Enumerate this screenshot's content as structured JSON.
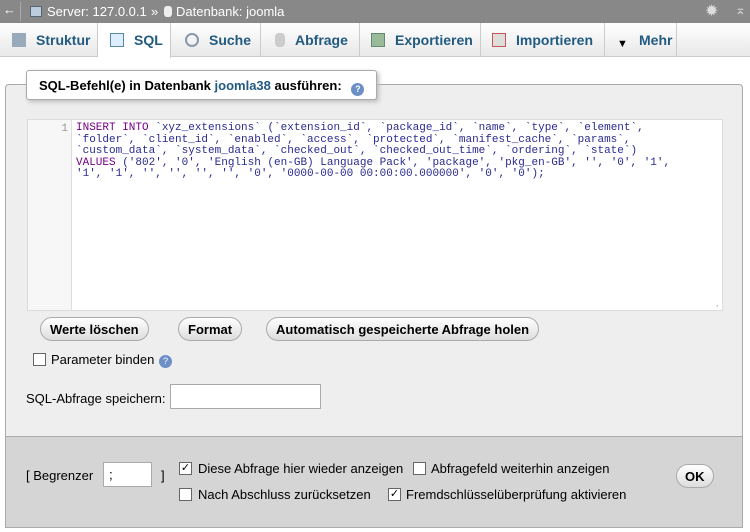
{
  "topbar": {
    "server": "Server: 127.0.0.1",
    "sep": "»",
    "database": "Datenbank: joomla"
  },
  "tabs": [
    {
      "label": "Struktur",
      "icon": "structure-icon"
    },
    {
      "label": "SQL",
      "icon": "sql-icon",
      "active": true
    },
    {
      "label": "Suche",
      "icon": "search-icon"
    },
    {
      "label": "Abfrage",
      "icon": "query-icon"
    },
    {
      "label": "Exportieren",
      "icon": "export-icon"
    },
    {
      "label": "Importieren",
      "icon": "import-icon"
    },
    {
      "label": "Mehr",
      "icon": "triangle-down-icon"
    }
  ],
  "legend": {
    "prefix": "SQL-Befehl(e) in Datenbank ",
    "db": "joomla38",
    "suffix": " ausführen:",
    "help": "?"
  },
  "editor": {
    "line_number": "1",
    "lines": [
      {
        "kw": "INSERT INTO",
        "rest": " `xyz_extensions` (`extension_id`, `package_id`, `name`, `type`, `element`,"
      },
      {
        "kw": "",
        "rest": "`folder`, `client_id`, `enabled`, `access`, `protected`, `manifest_cache`, `params`,"
      },
      {
        "kw": "",
        "rest": "`custom_data`, `system_data`, `checked_out`, `checked_out_time`, `ordering`, `state`)"
      },
      {
        "kw": "VALUES",
        "rest": " ('802', '0', 'English (en-GB) Language Pack', 'package', 'pkg_en-GB', '', '0', '1',"
      },
      {
        "kw": "",
        "rest": "'1', '1', '', '', '', '', '0', '0000-00-00 00:00:00.000000', '0', '0');"
      }
    ]
  },
  "buttons": {
    "clear": "Werte löschen",
    "format": "Format",
    "autosaved": "Automatisch gespeicherte Abfrage holen"
  },
  "bind_params": {
    "label": "Parameter binden",
    "checked": false
  },
  "save_query": {
    "label": "SQL-Abfrage speichern:",
    "value": ""
  },
  "footer": {
    "delimiter_open": "[ Begrenzer",
    "delimiter_value": ";",
    "delimiter_close": "]",
    "options": [
      {
        "label": "Diese Abfrage hier wieder anzeigen",
        "checked": true
      },
      {
        "label": "Abfragefeld weiterhin anzeigen",
        "checked": false
      },
      {
        "label": "Nach Abschluss zurücksetzen",
        "checked": false
      },
      {
        "label": "Fremdschlüsselüberprüfung aktivieren",
        "checked": true
      }
    ],
    "ok": "OK"
  }
}
